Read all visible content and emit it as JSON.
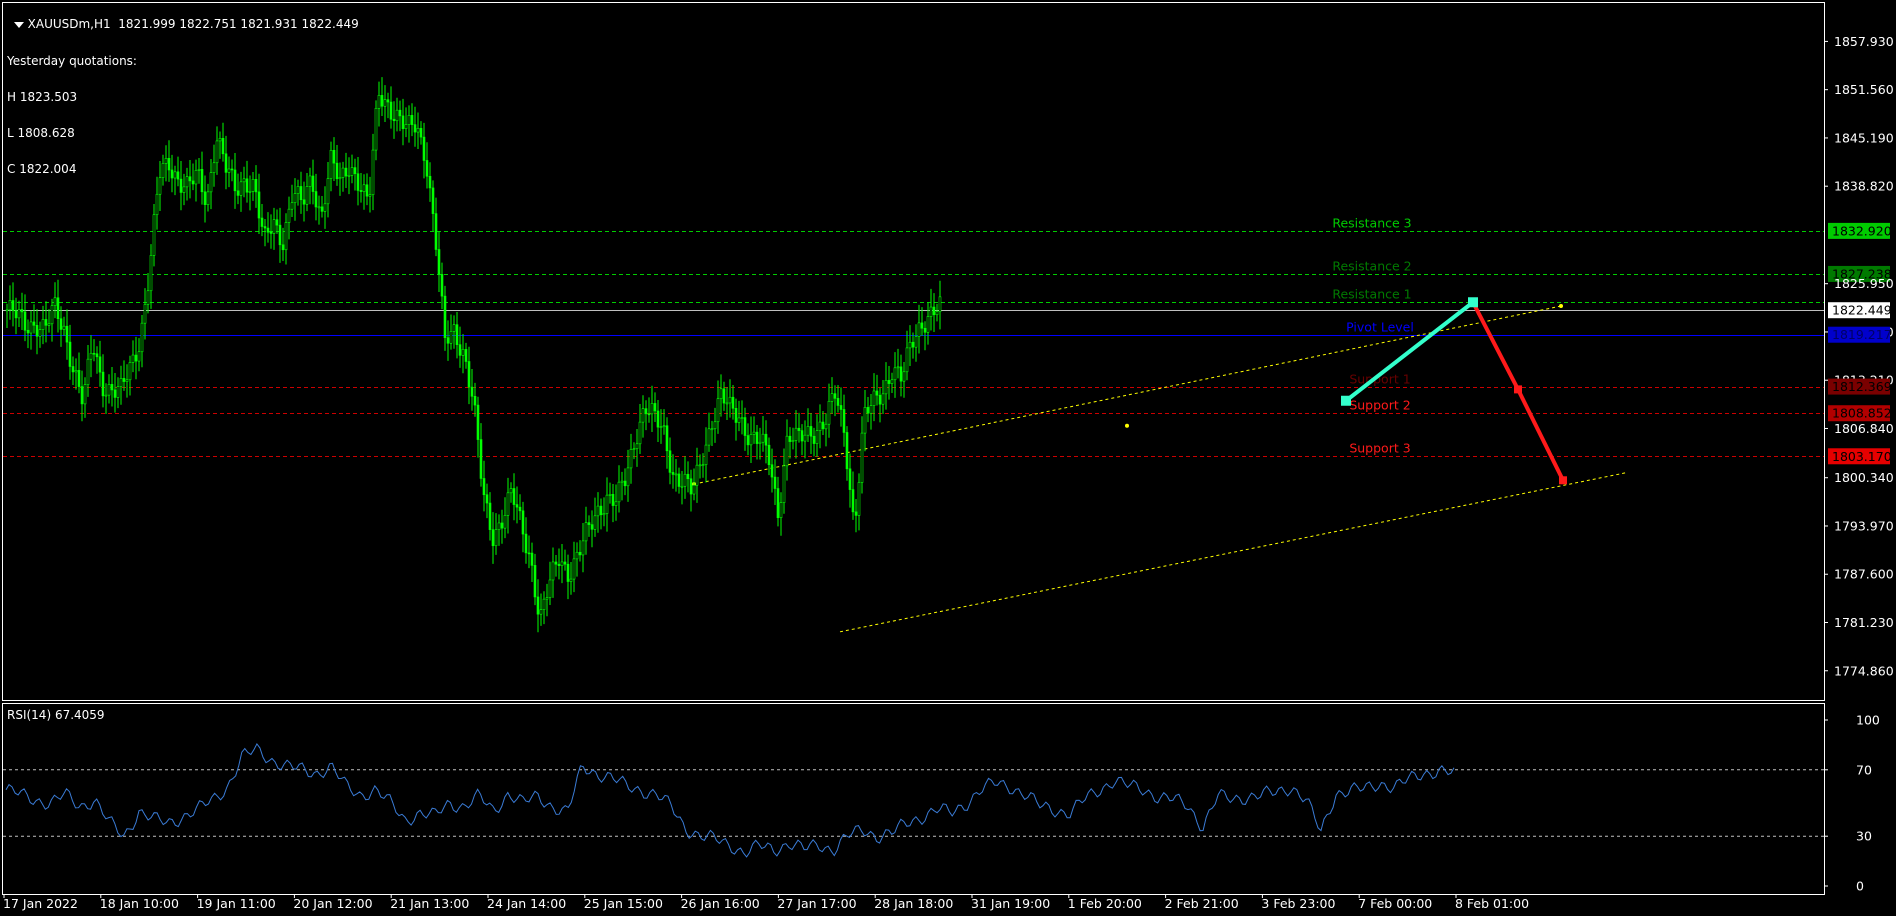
{
  "header": {
    "symbol_line": "XAUUSDm,H1  1821.999 1822.751 1821.931 1822.449",
    "yesterday_title": "Yesterday quotations:",
    "yesterday_high": "H 1823.503",
    "yesterday_low": "L 1808.628",
    "yesterday_close": "C 1822.004"
  },
  "rsi_header": "RSI(14) 67.4059",
  "colors": {
    "background": "#000000",
    "bull_candle": "#00ff00",
    "resistance": "#00cc00",
    "pivot": "#0000ff",
    "support": "#cc0000",
    "channel": "#ffff00",
    "arrow_up": "#33ffcc",
    "arrow_down": "#ff1a1a",
    "rsi_line": "#3a7bd5"
  },
  "chart_data": [
    {
      "type": "candlestick",
      "title": "XAUUSDm,H1",
      "ylim": [
        1771.0,
        1863.0
      ],
      "yticks": [
        "1857.930",
        "1851.560",
        "1845.190",
        "1838.820",
        "1832.920",
        "1827.238",
        "1825.950",
        "1822.449",
        "1819.580",
        "1819.217",
        "1813.210",
        "1812.369",
        "1808.852",
        "1806.840",
        "1803.170",
        "1800.340",
        "1793.970",
        "1787.600",
        "1781.230",
        "1774.860"
      ],
      "x_labels": [
        "17 Jan 2022",
        "18 Jan 10:00",
        "19 Jan 11:00",
        "20 Jan 12:00",
        "21 Jan 13:00",
        "24 Jan 14:00",
        "25 Jan 15:00",
        "26 Jan 16:00",
        "27 Jan 17:00",
        "28 Jan 18:00",
        "31 Jan 19:00",
        "1 Feb 20:00",
        "2 Feb 21:00",
        "3 Feb 23:00",
        "7 Feb 00:00",
        "8 Feb 01:00"
      ],
      "current_price": {
        "label": "1822.449",
        "value": 1822.449
      },
      "levels": [
        {
          "name": "Resistance 3",
          "value": 1832.92,
          "badge": "1832.920",
          "kind": "resistance"
        },
        {
          "name": "Resistance 2",
          "value": 1827.238,
          "badge": "1827.238",
          "kind": "resistance"
        },
        {
          "name": "Resistance 1",
          "value": 1823.503,
          "badge": "",
          "kind": "resistance"
        },
        {
          "name": "Pivot Level",
          "value": 1819.217,
          "badge": "1819.217",
          "kind": "pivot"
        },
        {
          "name": "Support 1",
          "value": 1812.369,
          "badge": "1812.369",
          "kind": "support"
        },
        {
          "name": "Support 2",
          "value": 1808.852,
          "badge": "1808.852",
          "kind": "support"
        },
        {
          "name": "Support 3",
          "value": 1803.17,
          "badge": "1803.170",
          "kind": "support"
        }
      ],
      "close_series": [
        1822.5,
        1821.5,
        1820.5,
        1821.0,
        1819.8,
        1822.5,
        1820.0,
        1815.0,
        1810.0,
        1818.0,
        1813.0,
        1812.0,
        1811.5,
        1815.0,
        1819.0,
        1828.0,
        1840.0,
        1842.0,
        1840.0,
        1838.5,
        1840.0,
        1837.0,
        1846.0,
        1841.0,
        1838.0,
        1840.0,
        1839.0,
        1831.0,
        1834.0,
        1832.0,
        1838.0,
        1836.0,
        1840.0,
        1835.0,
        1842.0,
        1839.0,
        1842.0,
        1839.5,
        1836.0,
        1851.0,
        1850.0,
        1848.0,
        1846.0,
        1847.0,
        1843.0,
        1832.0,
        1818.0,
        1820.0,
        1817.0,
        1810.0,
        1798.0,
        1793.0,
        1795.0,
        1798.0,
        1794.0,
        1790.0,
        1781.5,
        1786.0,
        1790.0,
        1788.0,
        1790.0,
        1793.0,
        1796.0,
        1798.0,
        1797.0,
        1800.0,
        1806.0,
        1810.0,
        1808.0,
        1806.0,
        1801.0,
        1800.0,
        1798.0,
        1803.0,
        1808.0,
        1811.0,
        1809.0,
        1808.5,
        1806.0,
        1805.0,
        1803.0,
        1796.0,
        1806.0,
        1805.0,
        1806.0,
        1807.0,
        1808.0,
        1811.0,
        1806.0,
        1794.0,
        1808.0,
        1810.0,
        1812.0,
        1815.0,
        1813.0,
        1818.0,
        1821.0,
        1822.0,
        1822.449
      ],
      "channel": {
        "start": {
          "x": "27 Jan 18:00",
          "y": 1780.0
        },
        "end": {
          "x": "8 Feb 03:00",
          "y": 1801.0
        },
        "upper_start": 1799.5,
        "upper_end": 1823.0
      },
      "projection": [
        {
          "x": "7 Feb 00:00",
          "y": 1810.5
        },
        {
          "x": "8 Feb 01:00",
          "y": 1823.5
        },
        {
          "x": "8 Feb 03:00",
          "y": 1812.0
        },
        {
          "x": "8 Feb 05:00",
          "y": 1800.0
        }
      ]
    },
    {
      "type": "line",
      "title": "RSI(14) 67.4059",
      "ylim": [
        0,
        100
      ],
      "yticks": [
        "100",
        "70",
        "30",
        "0"
      ],
      "levels": [
        70,
        30
      ],
      "values": [
        58,
        55,
        52,
        50,
        55,
        48,
        52,
        38,
        30,
        45,
        40,
        38,
        42,
        46,
        52,
        60,
        78,
        82,
        76,
        72,
        70,
        68,
        72,
        60,
        55,
        58,
        50,
        40,
        44,
        42,
        50,
        48,
        54,
        45,
        56,
        50,
        54,
        48,
        44,
        72,
        68,
        65,
        60,
        58,
        55,
        48,
        35,
        30,
        28,
        25,
        20,
        24,
        22,
        26,
        22,
        25,
        22,
        30,
        34,
        30,
        32,
        38,
        42,
        46,
        44,
        50,
        58,
        62,
        60,
        55,
        48,
        46,
        44,
        52,
        58,
        64,
        60,
        58,
        54,
        52,
        48,
        36,
        54,
        52,
        54,
        55,
        56,
        60,
        52,
        32,
        56,
        58,
        58,
        62,
        60,
        64,
        68,
        70,
        67.4
      ]
    }
  ]
}
